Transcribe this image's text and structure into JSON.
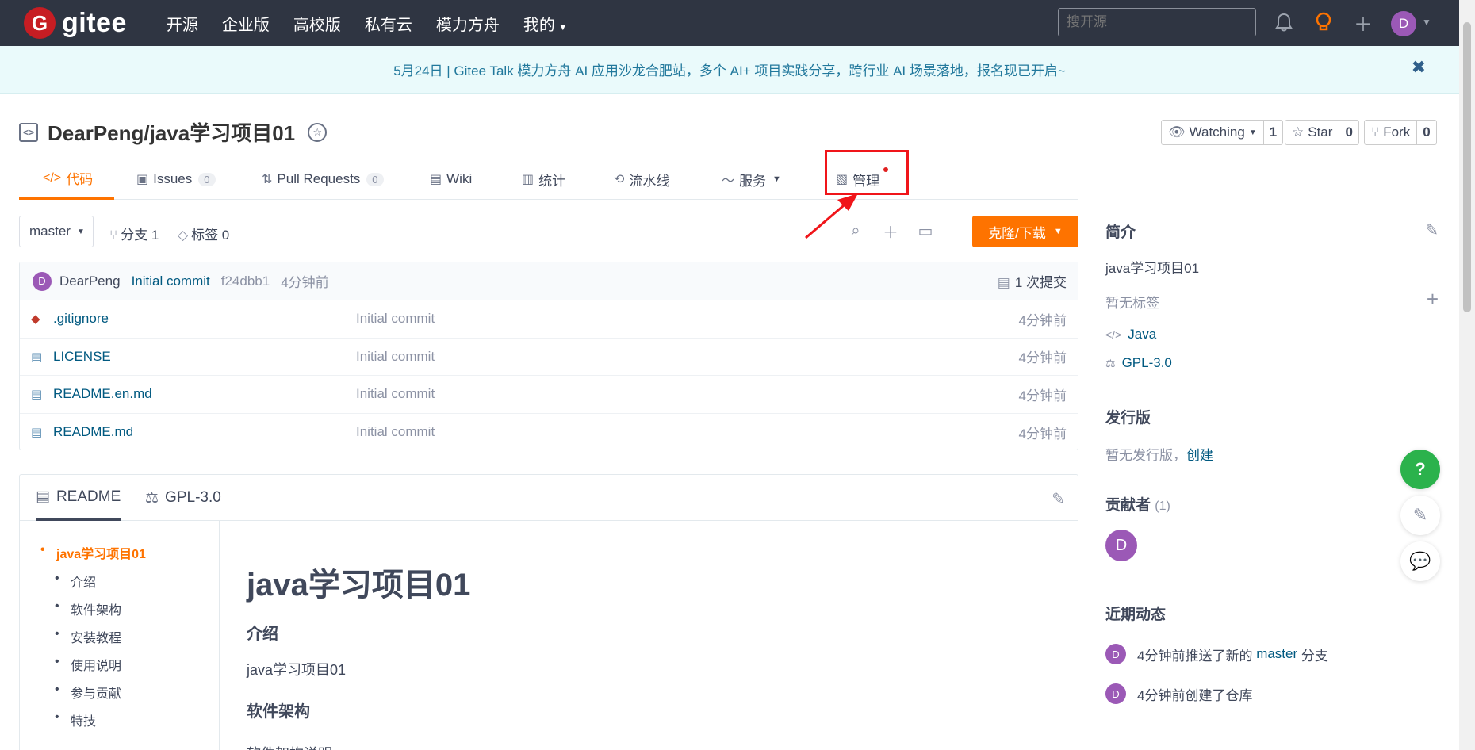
{
  "header": {
    "logo_text": "gitee",
    "logo_mark": "G",
    "nav": [
      "开源",
      "企业版",
      "高校版",
      "私有云",
      "模力方舟",
      "我的"
    ],
    "search_placeholder": "搜开源",
    "avatar_letter": "D"
  },
  "banner": {
    "text": "5月24日 | Gitee Talk 模力方舟 AI 应用沙龙合肥站，多个 AI+ 项目实践分享，跨行业 AI 场景落地，报名现已开启~",
    "close": "✖"
  },
  "repo": {
    "name": "DearPeng/java学习项目01",
    "watching_label": "Watching",
    "watching_count": "1",
    "star_label": "Star",
    "star_count": "0",
    "fork_label": "Fork",
    "fork_count": "0"
  },
  "tabs": {
    "code": "代码",
    "issues": "Issues",
    "issues_count": "0",
    "pr": "Pull Requests",
    "pr_count": "0",
    "wiki": "Wiki",
    "stats": "统计",
    "pipeline": "流水线",
    "service": "服务",
    "manage": "管理"
  },
  "branch": {
    "current": "master",
    "branches": "分支 1",
    "tags": "标签 0",
    "clone_label": "克隆/下载"
  },
  "commit": {
    "avatar": "D",
    "author": "DearPeng",
    "message": "Initial commit",
    "hash": "f24dbb1",
    "ago": "4分钟前",
    "count": "1 次提交"
  },
  "files": [
    {
      "name": ".gitignore",
      "msg": "Initial commit",
      "time": "4分钟前"
    },
    {
      "name": "LICENSE",
      "msg": "Initial commit",
      "time": "4分钟前"
    },
    {
      "name": "README.en.md",
      "msg": "Initial commit",
      "time": "4分钟前"
    },
    {
      "name": "README.md",
      "msg": "Initial commit",
      "time": "4分钟前"
    }
  ],
  "readme": {
    "tab_readme": "README",
    "tab_license": "GPL-3.0",
    "toc": [
      "java学习项目01",
      "介绍",
      "软件架构",
      "安装教程",
      "使用说明",
      "参与贡献",
      "特技"
    ],
    "title": "java学习项目01",
    "h_intro": "介绍",
    "p_intro": "java学习项目01",
    "h_arch": "软件架构",
    "p_arch": "软件架构说明"
  },
  "sidebar": {
    "intro_title": "简介",
    "intro_desc": "java学习项目01",
    "no_tags": "暂无标签",
    "lang": "Java",
    "license": "GPL-3.0",
    "release_title": "发行版",
    "no_release": "暂无发行版，",
    "create": "创建",
    "contrib_title": "贡献者",
    "contrib_count": "(1)",
    "contrib_avatar": "D",
    "activity_title": "近期动态",
    "activity": [
      {
        "avatar": "D",
        "pre": "4分钟前推送了新的 ",
        "link": "master",
        "post": " 分支"
      },
      {
        "avatar": "D",
        "pre": "4分钟前创建了仓库",
        "link": "",
        "post": ""
      }
    ]
  },
  "floating": {
    "help": "?"
  },
  "colors": {
    "accent": "#fe7300",
    "topbar": "#2f3542",
    "highlight": "#f0151a"
  }
}
